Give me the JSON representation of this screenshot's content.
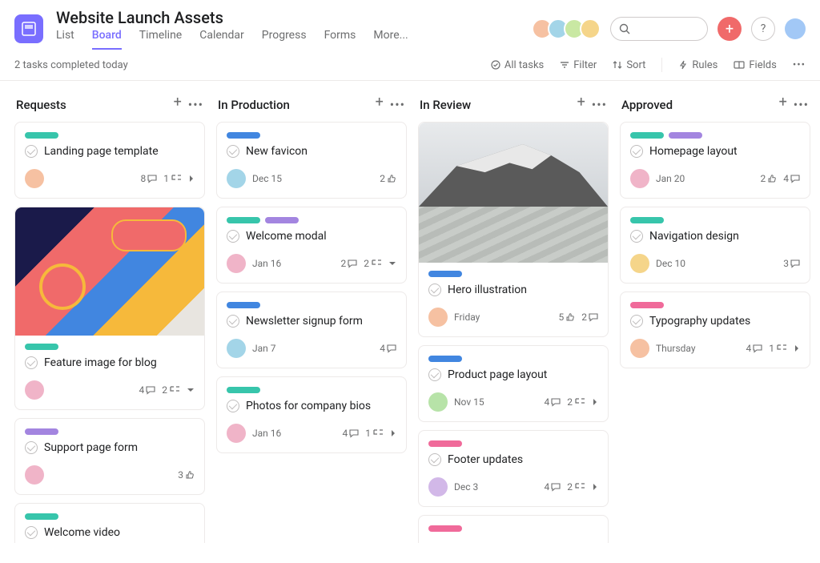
{
  "header": {
    "title": "Website Launch Assets",
    "tabs": [
      "List",
      "Board",
      "Timeline",
      "Calendar",
      "Progress",
      "Forms",
      "More..."
    ],
    "active_tab": "Board",
    "search_placeholder": ""
  },
  "toolbar": {
    "status_text": "2 tasks completed today",
    "all_tasks": "All tasks",
    "filter": "Filter",
    "sort": "Sort",
    "rules": "Rules",
    "fields": "Fields"
  },
  "columns": [
    {
      "title": "Requests",
      "cards": [
        {
          "tags": [
            "teal"
          ],
          "title": "Landing page template",
          "avatar": "av1",
          "date": "",
          "metrics": [
            {
              "n": 8,
              "t": "comment"
            },
            {
              "n": 1,
              "t": "subtask"
            },
            {
              "n": "",
              "t": "chevron"
            }
          ]
        },
        {
          "image": "design",
          "tags": [
            "teal"
          ],
          "title": "Feature image for blog",
          "avatar": "av3",
          "date": "",
          "metrics": [
            {
              "n": 4,
              "t": "comment"
            },
            {
              "n": 2,
              "t": "subtask"
            },
            {
              "n": "",
              "t": "caret"
            }
          ]
        },
        {
          "tags": [
            "purple"
          ],
          "title": "Support page form",
          "avatar": "av3",
          "date": "",
          "metrics": [
            {
              "n": 3,
              "t": "like"
            }
          ]
        },
        {
          "tags": [
            "teal"
          ],
          "title": "Welcome video",
          "avatar": "",
          "date": "",
          "metrics": []
        }
      ]
    },
    {
      "title": "In Production",
      "cards": [
        {
          "tags": [
            "blue"
          ],
          "title": "New favicon",
          "avatar": "av2",
          "date": "Dec 15",
          "metrics": [
            {
              "n": 2,
              "t": "like"
            }
          ]
        },
        {
          "tags": [
            "teal",
            "purple"
          ],
          "title": "Welcome modal",
          "avatar": "av3",
          "date": "Jan 16",
          "metrics": [
            {
              "n": 2,
              "t": "comment"
            },
            {
              "n": 2,
              "t": "subtask"
            },
            {
              "n": "",
              "t": "caret"
            }
          ]
        },
        {
          "tags": [
            "blue"
          ],
          "title": "Newsletter signup form",
          "avatar": "av2",
          "date": "Jan 7",
          "metrics": [
            {
              "n": 4,
              "t": "comment"
            }
          ]
        },
        {
          "tags": [
            "teal"
          ],
          "title": "Photos for company bios",
          "avatar": "av3",
          "date": "Jan 16",
          "metrics": [
            {
              "n": 4,
              "t": "comment"
            },
            {
              "n": 1,
              "t": "subtask"
            },
            {
              "n": "",
              "t": "chevron"
            }
          ]
        }
      ]
    },
    {
      "title": "In Review",
      "cards": [
        {
          "image": "hero",
          "tags": [
            "blue"
          ],
          "title": "Hero illustration",
          "avatar": "av1",
          "date": "Friday",
          "metrics": [
            {
              "n": 5,
              "t": "like"
            },
            {
              "n": 2,
              "t": "comment"
            }
          ]
        },
        {
          "tags": [
            "blue"
          ],
          "title": "Product page layout",
          "avatar": "av4",
          "date": "Nov 15",
          "metrics": [
            {
              "n": 4,
              "t": "comment"
            },
            {
              "n": 2,
              "t": "subtask"
            },
            {
              "n": "",
              "t": "chevron"
            }
          ]
        },
        {
          "tags": [
            "pink"
          ],
          "title": "Footer updates",
          "avatar": "av5",
          "date": "Dec 3",
          "metrics": [
            {
              "n": 4,
              "t": "comment"
            },
            {
              "n": 2,
              "t": "subtask"
            },
            {
              "n": "",
              "t": "chevron"
            }
          ]
        },
        {
          "tags": [
            "pink"
          ],
          "title": "",
          "avatar": "",
          "date": "",
          "metrics": []
        }
      ]
    },
    {
      "title": "Approved",
      "cards": [
        {
          "tags": [
            "teal",
            "purple"
          ],
          "title": "Homepage layout",
          "avatar": "av3",
          "date": "Jan 20",
          "metrics": [
            {
              "n": 2,
              "t": "like"
            },
            {
              "n": 4,
              "t": "comment"
            }
          ]
        },
        {
          "tags": [
            "teal"
          ],
          "title": "Navigation design",
          "avatar": "av6",
          "date": "Dec 10",
          "metrics": [
            {
              "n": 3,
              "t": "comment"
            }
          ]
        },
        {
          "tags": [
            "pink"
          ],
          "title": "Typography updates",
          "avatar": "av1",
          "date": "Thursday",
          "metrics": [
            {
              "n": 4,
              "t": "comment"
            },
            {
              "n": 1,
              "t": "subtask"
            },
            {
              "n": "",
              "t": "chevron"
            }
          ]
        }
      ]
    }
  ]
}
